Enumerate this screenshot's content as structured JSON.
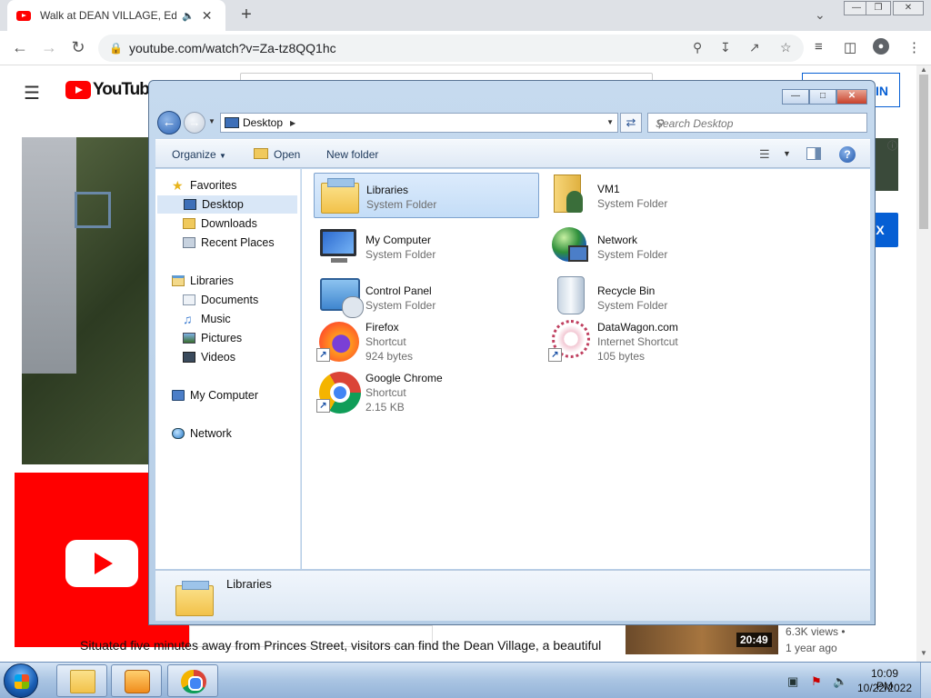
{
  "browser": {
    "tab_title": "Walk at DEAN VILLAGE, Edin",
    "audio_icon": "speaker-icon",
    "url": "youtube.com/watch?v=Za-tz8QQ1hc"
  },
  "youtube": {
    "logo_text": "YouTube",
    "signin_label": "IN",
    "side_button_label": "X",
    "description": "Situated five minutes away from Princes Street, visitors can find the Dean Village, a beautiful",
    "rec_duration": "20:49",
    "rec_views": "6.3K views •",
    "rec_age": "1 year ago",
    "brand_color": "#ff0000"
  },
  "explorer": {
    "address_location": "Desktop",
    "search_placeholder": "Search Desktop",
    "commands": {
      "organize": "Organize",
      "open": "Open",
      "new_folder": "New folder"
    },
    "nav": {
      "favorites": "Favorites",
      "desktop": "Desktop",
      "downloads": "Downloads",
      "recent_places": "Recent Places",
      "libraries": "Libraries",
      "documents": "Documents",
      "music": "Music",
      "pictures": "Pictures",
      "videos": "Videos",
      "my_computer": "My Computer",
      "network": "Network"
    },
    "items": [
      {
        "name": "Libraries",
        "line2": "System Folder",
        "line3": "",
        "icon": "libraries-folder-icon"
      },
      {
        "name": "VM1",
        "line2": "System Folder",
        "line3": "",
        "icon": "user-folder-icon"
      },
      {
        "name": "My Computer",
        "line2": "System Folder",
        "line3": "",
        "icon": "computer-icon"
      },
      {
        "name": "Network",
        "line2": "System Folder",
        "line3": "",
        "icon": "network-icon"
      },
      {
        "name": "Control Panel",
        "line2": "System Folder",
        "line3": "",
        "icon": "control-panel-icon"
      },
      {
        "name": "Recycle Bin",
        "line2": "System Folder",
        "line3": "",
        "icon": "recycle-bin-icon"
      },
      {
        "name": "Firefox",
        "line2": "Shortcut",
        "line3": "924 bytes",
        "icon": "firefox-icon"
      },
      {
        "name": "DataWagon.com",
        "line2": "Internet Shortcut",
        "line3": "105 bytes",
        "icon": "datawagon-icon"
      },
      {
        "name": "Google Chrome",
        "line2": "Shortcut",
        "line3": "2.15 KB",
        "icon": "chrome-icon"
      }
    ],
    "details_name": "Libraries",
    "selection_color": "#c4ddf7"
  },
  "taskbar": {
    "time": "10:09 PM",
    "date": "10/22/2022"
  }
}
